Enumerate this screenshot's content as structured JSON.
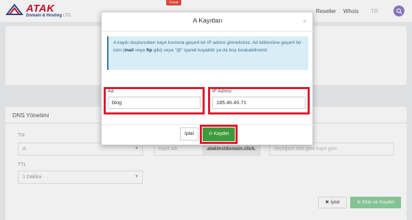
{
  "brand": {
    "name": "ATAK",
    "tagline": "Domain & Hosting",
    "tagline_suffix": "LTD.",
    "colors": {
      "red": "#c8102e",
      "blue": "#2a4a8a"
    }
  },
  "header": {
    "promo_badge": "Fırsat",
    "nav": [
      "Reseller",
      "Whois",
      "TR"
    ],
    "search_icon": "search-icon"
  },
  "dns_section": {
    "title": "DNS Yönetimi",
    "type_label": "Tür",
    "type_value": "A",
    "name_placeholder": "Kayıt adı",
    "domain_suffix": ".ataktestdomain.click.",
    "value_placeholder": "Seçtiğiniz türe göre kayıt girin",
    "ttl_label": "TTL",
    "ttl_value": "1 Dakika",
    "cancel_label": "İptal",
    "save_label": "Ekle ve Kaydet"
  },
  "modal": {
    "title": "A Kayıtları",
    "close_glyph": "×",
    "info_text": {
      "part1": "A kaydı oluştururken kayıt kısmına geçerli bir IP adresi girmelisiniz. Ad bölümüne geçerli bir isim (",
      "bold1": "mail",
      "part2": " veya ",
      "bold2": "ftp",
      "part3": " gibi) veya \"@\" işareti koyabilir ya da boş bırakabilirsiniz"
    },
    "name_label": "Ad",
    "name_value": "blog",
    "ip_label": "IP Adresi",
    "ip_value": "185.46.40.71",
    "cancel_label": "İptal",
    "save_label": "Kaydet",
    "highlight_color": "#e4142b",
    "save_color": "#3c9b3c",
    "info_bg": "#d9edf7"
  }
}
